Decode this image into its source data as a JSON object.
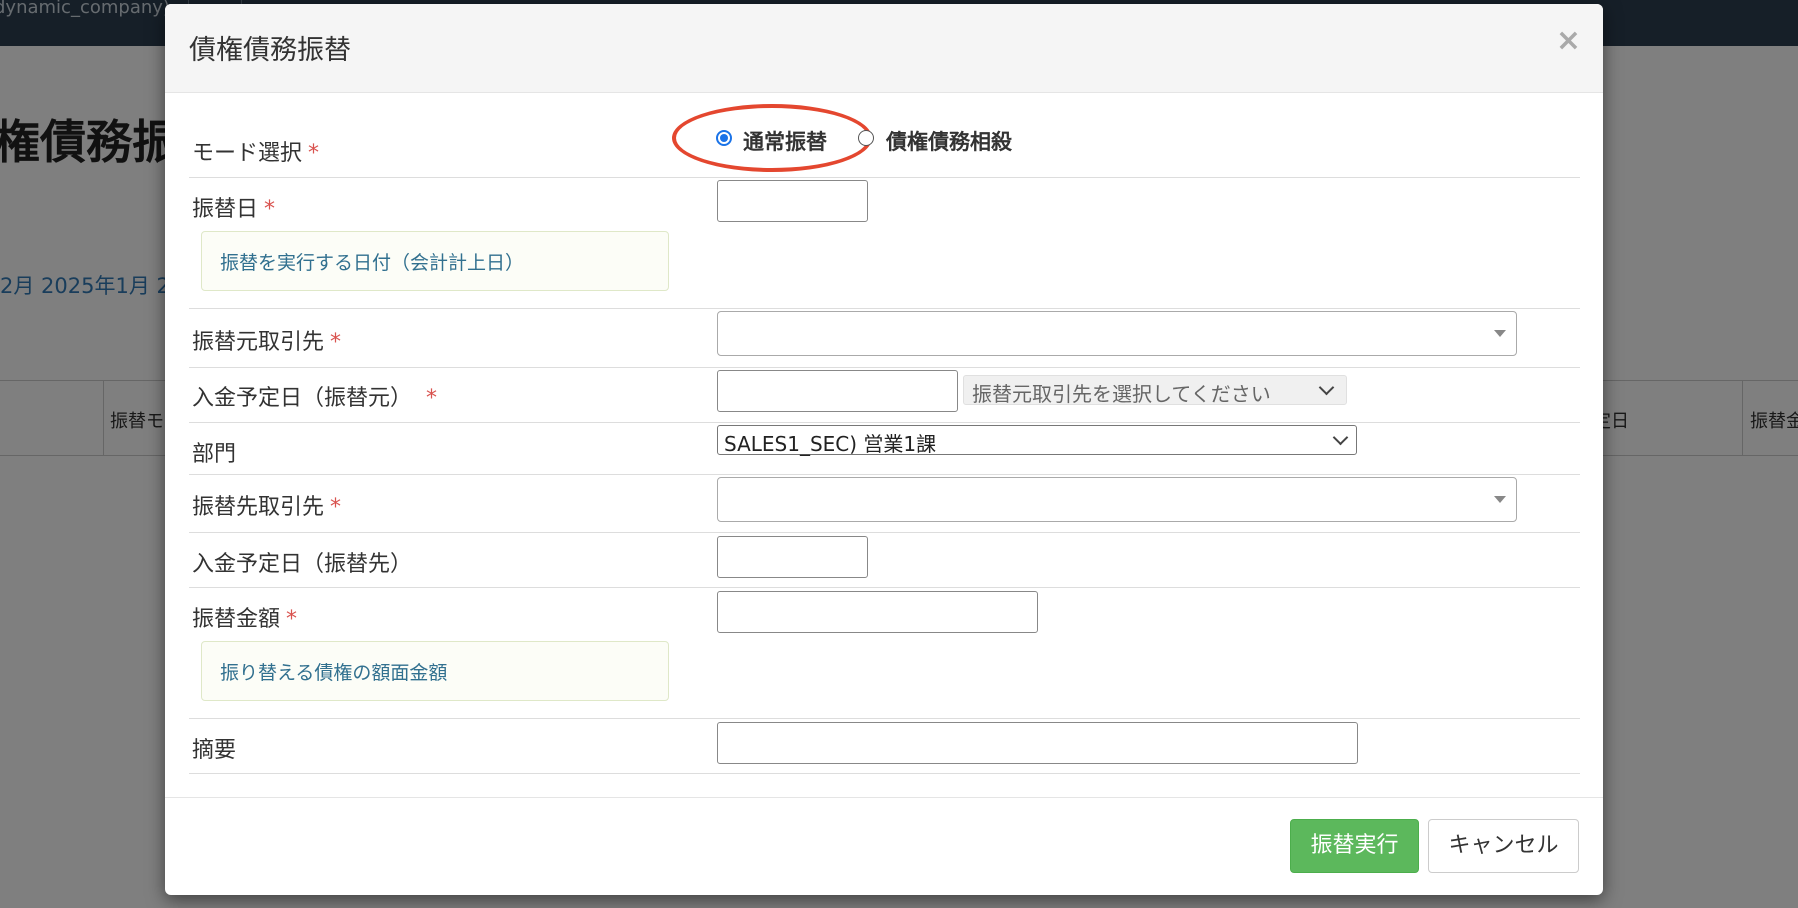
{
  "background": {
    "company_text": "dynamic_company)",
    "page_title": "権債務振",
    "months_text": "2月 2025年1月 2",
    "table_headers": [
      "振替モ",
      "定日",
      "振替金"
    ]
  },
  "modal": {
    "title": "債権債務振替",
    "close_symbol": "×",
    "mode": {
      "label": "モード選択",
      "required_mark": "*",
      "options": [
        "通常振替",
        "債権債務相殺"
      ],
      "selected": "通常振替"
    },
    "transfer_date": {
      "label": "振替日",
      "required_mark": "*",
      "help": "振替を実行する日付（会計計上日）",
      "value": ""
    },
    "source_partner": {
      "label": "振替元取引先",
      "required_mark": "*",
      "value": ""
    },
    "source_payment_date": {
      "label": "入金予定日（振替元）",
      "required_mark": "*",
      "value": "",
      "select_placeholder": "振替元取引先を選択してください"
    },
    "department": {
      "label": "部門",
      "selected": "SALES1_SEC) 営業1課"
    },
    "dest_partner": {
      "label": "振替先取引先",
      "required_mark": "*",
      "value": ""
    },
    "dest_payment_date": {
      "label": "入金予定日（振替先）",
      "value": ""
    },
    "amount": {
      "label": "振替金額",
      "required_mark": "*",
      "help": "振り替える債権の額面金額",
      "value": ""
    },
    "memo": {
      "label": "摘要",
      "value": ""
    },
    "buttons": {
      "execute": "振替実行",
      "cancel": "キャンセル"
    }
  },
  "colors": {
    "primary_button": "#5cb85c",
    "required_mark": "#d9534f",
    "radio_accent": "#1a73e8",
    "annotation_circle": "#e4472f",
    "help_text": "#31708f"
  }
}
